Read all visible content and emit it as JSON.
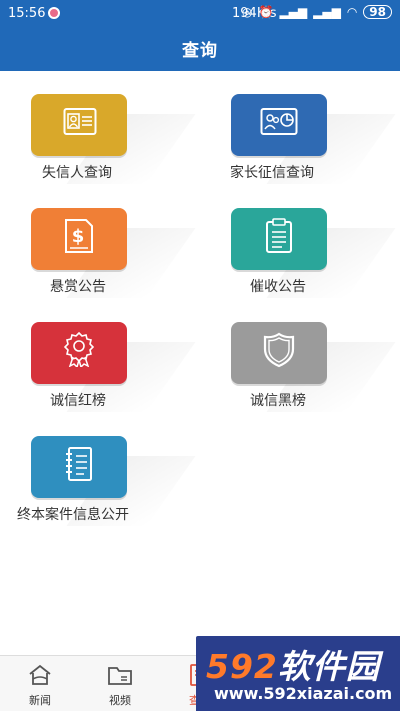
{
  "status_bar": {
    "time": "15:56",
    "speed": "194K/s",
    "battery": "98"
  },
  "header": {
    "title": "查询"
  },
  "tiles": [
    {
      "label": "失信人查询",
      "color": "#d9a82a",
      "icon": "id-card-icon"
    },
    {
      "label": "家长征信查询",
      "color": "#2f6ab3",
      "icon": "family-report-icon"
    },
    {
      "label": "悬赏公告",
      "color": "#f07f36",
      "icon": "dollar-document-icon"
    },
    {
      "label": "催收公告",
      "color": "#2aa69a",
      "icon": "clipboard-icon"
    },
    {
      "label": "诚信红榜",
      "color": "#d6323b",
      "icon": "award-badge-icon"
    },
    {
      "label": "诚信黑榜",
      "color": "#9b9b9b",
      "icon": "shield-icon"
    },
    {
      "label": "终本案件信息公开",
      "color": "#2f8fbf",
      "icon": "notebook-icon"
    }
  ],
  "nav": [
    {
      "label": "新闻",
      "icon": "home-icon"
    },
    {
      "label": "视频",
      "icon": "folder-icon"
    },
    {
      "label": "查询",
      "icon": "query-icon"
    },
    {
      "label": "",
      "icon": "megaphone-icon"
    },
    {
      "label": "",
      "icon": "user-icon"
    }
  ],
  "watermark": {
    "digits": "592",
    "text": "软件园",
    "url": "www.592xiazai.com"
  }
}
